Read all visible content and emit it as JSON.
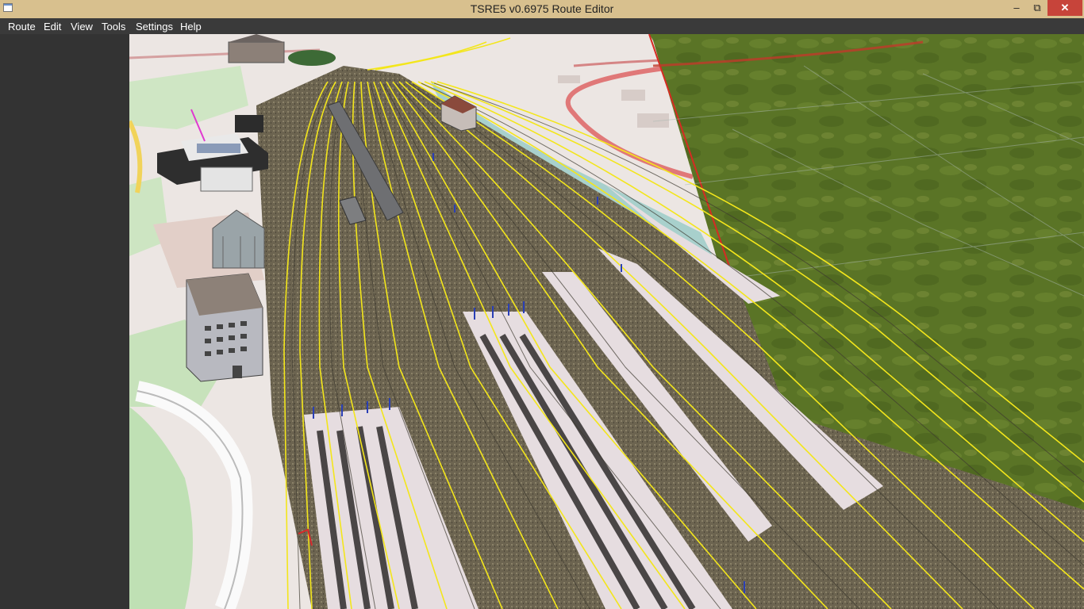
{
  "window": {
    "title": "TSRE5 v0.6975 Route Editor",
    "icon": "app-icon",
    "controls": {
      "minimize": "minimize-icon",
      "maximize": "maximize-icon",
      "close": "close-icon"
    }
  },
  "menu": {
    "items": [
      {
        "label": "Route"
      },
      {
        "label": "Edit"
      },
      {
        "label": "View"
      },
      {
        "label": "Tools"
      },
      {
        "label": "Settings"
      },
      {
        "label": "Help"
      }
    ]
  },
  "colors": {
    "titlebar": "#d8c08e",
    "menubar": "#3a3a3a",
    "sidepanel": "#333333",
    "terrain_green": "#5a7426",
    "track_yellow": "#f3e61b",
    "boundary_red": "#d62b22",
    "map_river": "#a8d0cc",
    "map_road": "#e07878"
  }
}
